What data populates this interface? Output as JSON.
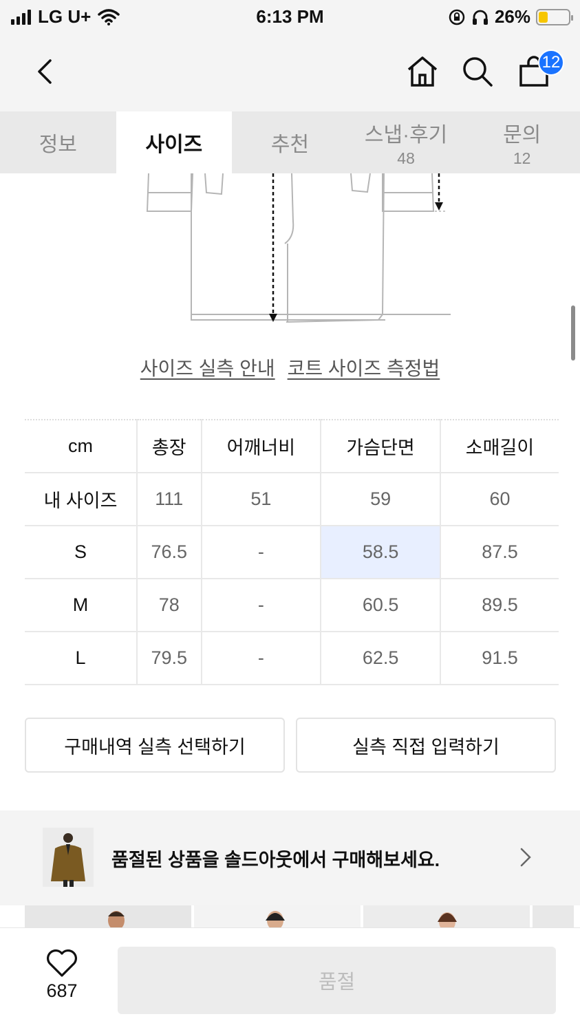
{
  "status_bar": {
    "carrier": "LG U+",
    "time": "6:13 PM",
    "battery": "26%",
    "battery_color": "#f7c600"
  },
  "header": {
    "icons": [
      "back-icon",
      "home-icon",
      "search-icon",
      "cart-icon"
    ],
    "cart_badge": "12",
    "badge_color": "#1a73ff"
  },
  "tabs": [
    {
      "label": "정보",
      "count": ""
    },
    {
      "label": "사이즈",
      "count": ""
    },
    {
      "label": "추천",
      "count": ""
    },
    {
      "label": "스냅·후기",
      "count": "48"
    },
    {
      "label": "문의",
      "count": "12"
    }
  ],
  "guide": {
    "link1": "사이즈 실측 안내",
    "link2": "코트 사이즈 측정법"
  },
  "size_table": {
    "headers": [
      "cm",
      "총장",
      "어깨너비",
      "가슴단면",
      "소매길이"
    ],
    "rows": [
      [
        "내 사이즈",
        "111",
        "51",
        "59",
        "60"
      ],
      [
        "S",
        "76.5",
        "-",
        "58.5",
        "87.5"
      ],
      [
        "M",
        "78",
        "-",
        "60.5",
        "89.5"
      ],
      [
        "L",
        "79.5",
        "-",
        "62.5",
        "91.5"
      ]
    ],
    "highlight_color": "#e8efff"
  },
  "actions": {
    "purchase_history": "구매내역 실측 선택하기",
    "manual_input": "실측 직접 입력하기"
  },
  "soldout_banner": {
    "text": "품절된 상품을 솔드아웃에서 구매해보세요."
  },
  "bottom_bar": {
    "like_count": "687",
    "buy_label": "품절"
  }
}
